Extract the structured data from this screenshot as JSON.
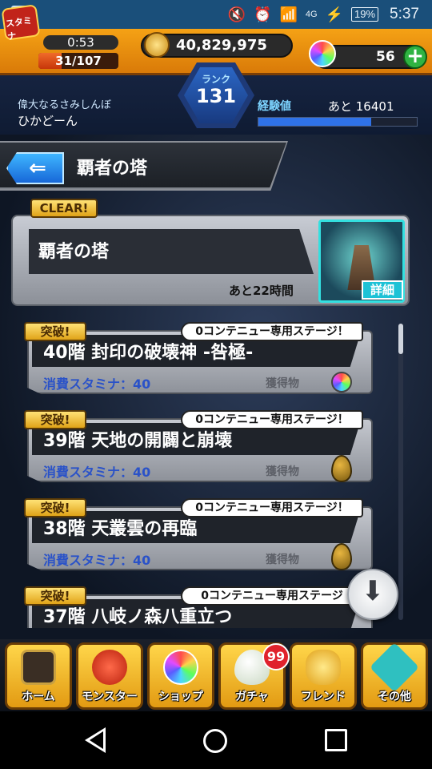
{
  "status_bar": {
    "network": "4G",
    "battery": "19%",
    "time": "5:37"
  },
  "header": {
    "stamina_label": "スタミナ",
    "stamina_timer": "0:53",
    "stamina": "31/107",
    "stamina_fraction": 0.29,
    "gold": "40,829,975",
    "orbs": "56",
    "rank_label": "ランク",
    "rank": "131",
    "player_title": "偉大なるさみしんぼ",
    "player_name": "ひかどーん",
    "exp_label": "経験値",
    "exp_remaining": "あと 16401",
    "exp_fraction": 0.71
  },
  "page": {
    "title": "覇者の塔"
  },
  "tower": {
    "clear_badge": "CLEAR!",
    "name": "覇者の塔",
    "time_left": "あと22時間",
    "detail_label": "詳細"
  },
  "stages": [
    {
      "badge": "突破!",
      "note": "0コンテニュー専用ステージ！",
      "title": "40階 封印の破壊神 -咎極-",
      "stamina": "消費スタミナ：40",
      "drop_label": "獲得物",
      "drop_icon": "rainbow-orb-icon"
    },
    {
      "badge": "突破!",
      "note": "0コンテニュー専用ステージ！",
      "title": "39階 天地の開闢と崩壊",
      "stamina": "消費スタミナ：40",
      "drop_label": "獲得物",
      "drop_icon": "gold-egg-icon"
    },
    {
      "badge": "突破!",
      "note": "0コンテニュー専用ステージ！",
      "title": "38階 天叢雲の再臨",
      "stamina": "消費スタミナ：40",
      "drop_label": "獲得物",
      "drop_icon": "gold-egg-icon"
    },
    {
      "badge": "突破!",
      "note": "0コンテニュー専用ステージ",
      "title": "37階 八岐ノ森八重立つ",
      "stamina": "",
      "drop_label": "",
      "drop_icon": ""
    }
  ],
  "bottom_nav": {
    "home": "ホーム",
    "monster": "モンスター",
    "shop": "ショップ",
    "gacha": "ガチャ",
    "gacha_badge": "99",
    "friend": "フレンド",
    "other": "その他"
  },
  "colors": {
    "header_orange": "#f5a215",
    "rank_blue": "#2b66c4",
    "badge_gold": "#ffe276",
    "exp_blue": "#2f72e8",
    "accent_cyan": "#1dc2d6"
  }
}
